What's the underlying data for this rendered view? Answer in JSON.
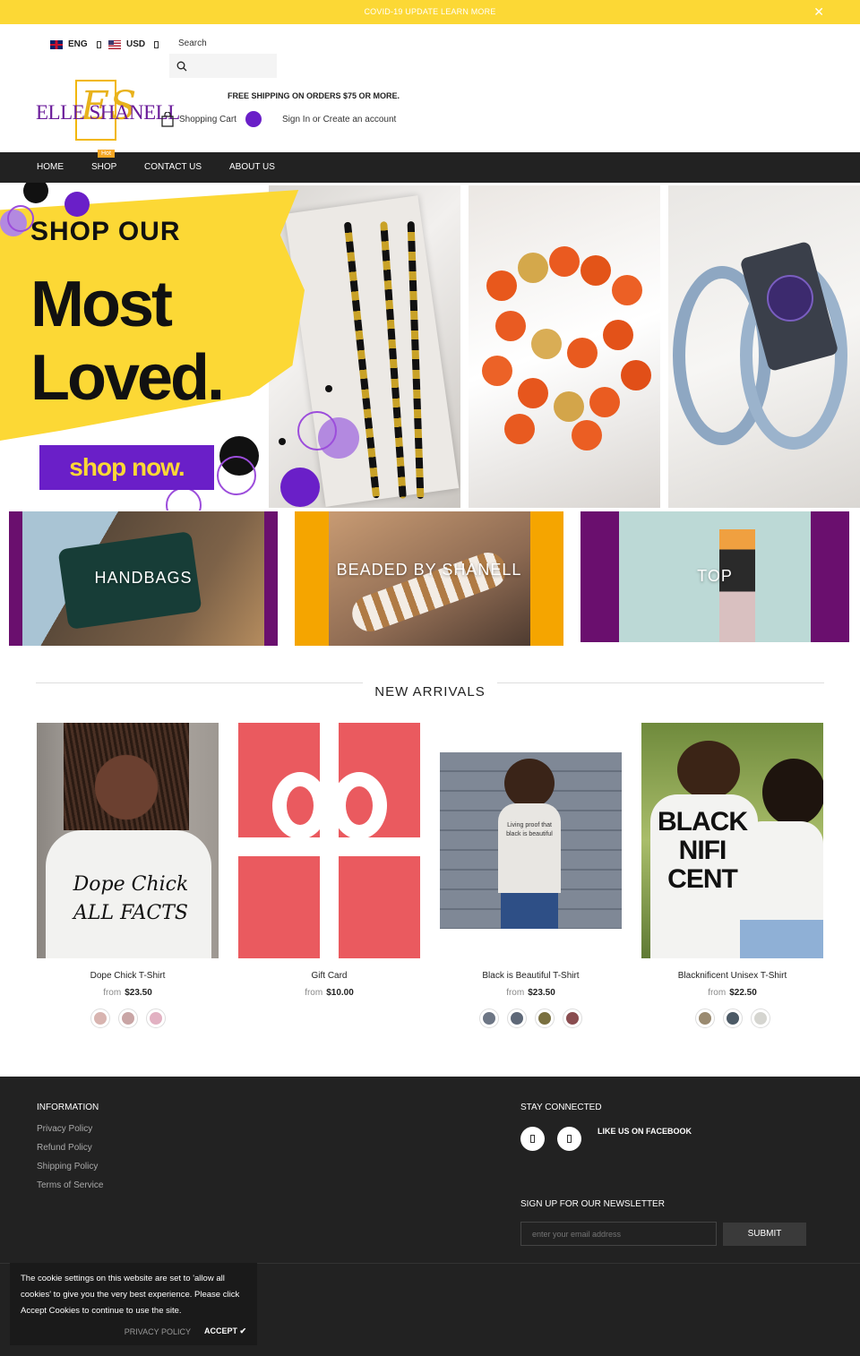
{
  "announcement": {
    "text": "COVID-19 UPDATE LEARN MORE",
    "close_icon": "close-icon"
  },
  "header": {
    "language": "ENG",
    "currency": "USD",
    "search_label": "Search",
    "search_placeholder": "",
    "logo_text": "ELLE SHANELL",
    "logo_monogram": "ES",
    "free_shipping": "FREE SHIPPING ON ORDERS $75 OR MORE.",
    "cart_label": "Shopping Cart",
    "account_label": "Sign In or Create an account"
  },
  "nav": {
    "items": [
      {
        "label": "HOME"
      },
      {
        "label": "SHOP"
      },
      {
        "label": "CONTACT US"
      },
      {
        "label": "ABOUT US"
      }
    ],
    "hot_badge": "Hot"
  },
  "hero": {
    "line1": "SHOP OUR",
    "line2": "Most",
    "line3": "Loved.",
    "cta": "shop now.",
    "colors": {
      "yellow": "#fcd835",
      "purple": "#6a1fc8"
    }
  },
  "categories": [
    {
      "label": "HANDBAGS"
    },
    {
      "label": "BEADED BY SHANELL"
    },
    {
      "label": "TOP"
    }
  ],
  "new_arrivals": {
    "title": "NEW ARRIVALS",
    "products": [
      {
        "name": "Dope Chick T-Shirt",
        "from": "from",
        "price": "$23.50",
        "print_text": "Dope Chick ALL FACTS"
      },
      {
        "name": "Gift Card",
        "from": "from",
        "price": "$10.00"
      },
      {
        "name": "Black is Beautiful T-Shirt",
        "from": "from",
        "price": "$23.50",
        "print_text": "Living proof that black is beautiful"
      },
      {
        "name": "Blacknificent Unisex T-Shirt",
        "from": "from",
        "price": "$22.50",
        "print_text": "BLACK NIFI CENT"
      }
    ]
  },
  "footer": {
    "info_title": "INFORMATION",
    "links": [
      "Privacy Policy",
      "Refund Policy",
      "Shipping Policy",
      "Terms of Service"
    ],
    "stay_title": "STAY CONNECTED",
    "facebook_text": "LIKE US ON FACEBOOK",
    "newsletter_title": "SIGN UP FOR OUR NEWSLETTER",
    "email_placeholder": "enter your email address",
    "submit_label": "SUBMIT"
  },
  "cookie": {
    "message": "The cookie settings on this website are set to 'allow all cookies' to give you the very best experience. Please click Accept Cookies to continue to use the site.",
    "privacy_label": "PRIVACY POLICY",
    "accept_label": "ACCEPT ✔"
  }
}
